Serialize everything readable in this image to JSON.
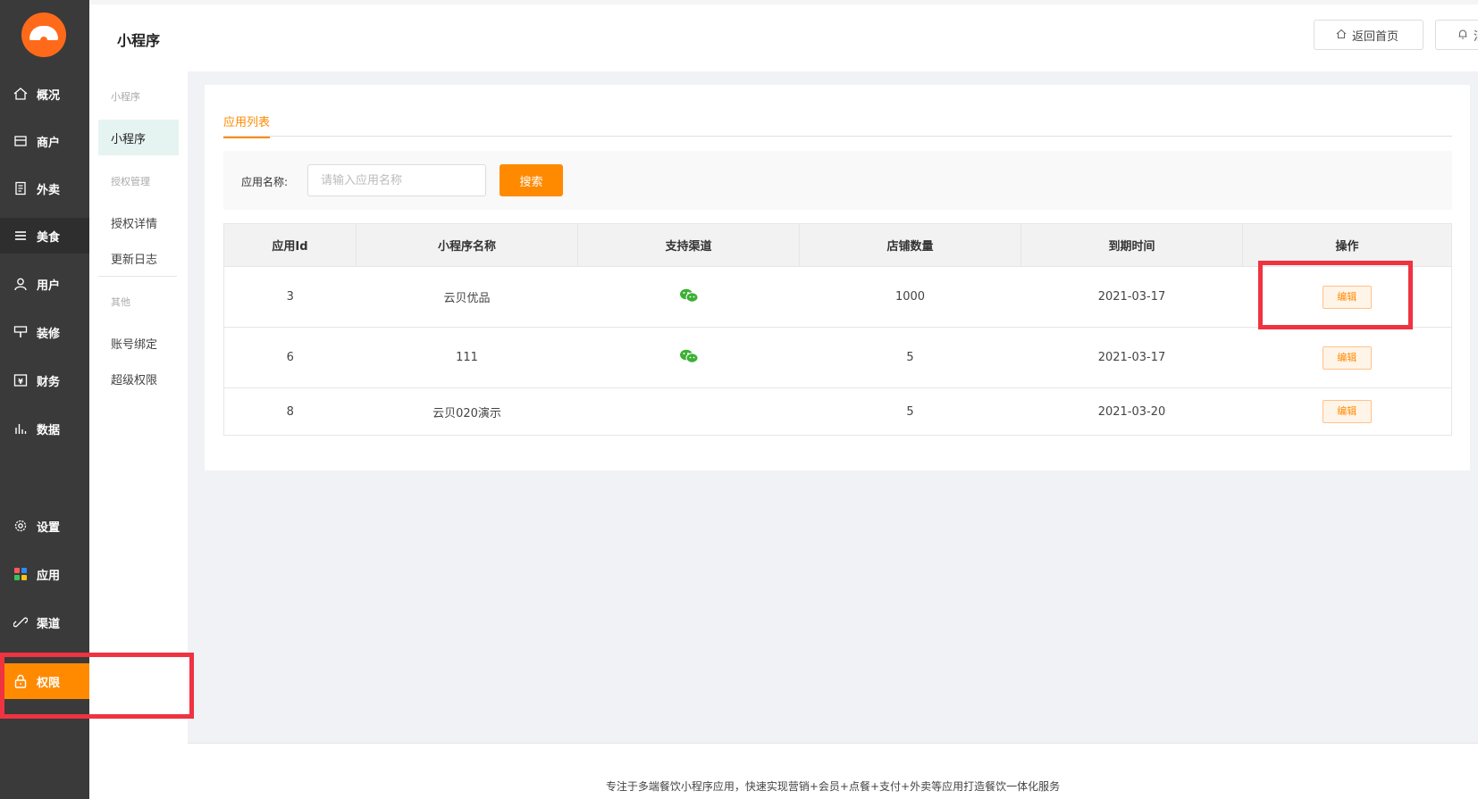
{
  "header": {
    "page_title": "小程序",
    "home_button": "返回首页",
    "notify_button": "消"
  },
  "nav": [
    {
      "label": "概况",
      "icon": "home-icon"
    },
    {
      "label": "商户",
      "icon": "shop-icon"
    },
    {
      "label": "外卖",
      "icon": "takeout-icon"
    },
    {
      "label": "美食",
      "icon": "menu-icon"
    },
    {
      "label": "用户",
      "icon": "user-icon"
    },
    {
      "label": "装修",
      "icon": "brush-icon"
    },
    {
      "label": "财务",
      "icon": "finance-icon"
    },
    {
      "label": "数据",
      "icon": "chart-icon"
    },
    {
      "label": "设置",
      "icon": "gear-icon"
    },
    {
      "label": "应用",
      "icon": "apps-icon"
    },
    {
      "label": "渠道",
      "icon": "channel-icon"
    },
    {
      "label": "权限",
      "icon": "lock-icon"
    }
  ],
  "subnav": {
    "group1": "小程序",
    "item_miniprogram": "小程序",
    "group2": "授权管理",
    "item_auth_detail": "授权详情",
    "item_update_log": "更新日志",
    "group3": "其他",
    "item_account_bind": "账号绑定",
    "item_super_perm": "超级权限"
  },
  "tabs": {
    "app_list": "应用列表"
  },
  "filter": {
    "label": "应用名称:",
    "placeholder": "请输入应用名称",
    "value": "",
    "search_button": "搜索"
  },
  "table": {
    "columns": [
      "应用Id",
      "小程序名称",
      "支持渠道",
      "店铺数量",
      "到期时间",
      "操作"
    ],
    "rows": [
      {
        "id": "3",
        "name": "云贝优品",
        "channel": "wechat",
        "shops": "1000",
        "expire": "2021-03-17",
        "action": "编辑"
      },
      {
        "id": "6",
        "name": "111",
        "channel": "wechat",
        "shops": "5",
        "expire": "2021-03-17",
        "action": "编辑"
      },
      {
        "id": "8",
        "name": "云贝020演示",
        "channel": "",
        "shops": "5",
        "expire": "2021-03-20",
        "action": "编辑"
      }
    ]
  },
  "footer": {
    "text": "专注于多端餐饮小程序应用，快速实现营销+会员+点餐+支付+外卖等应用打造餐饮一体化服务"
  },
  "colors": {
    "accent": "#ff8a00",
    "sidebar": "#3a3a3a",
    "highlight": "#ef3340",
    "wechat": "#3cb034"
  }
}
